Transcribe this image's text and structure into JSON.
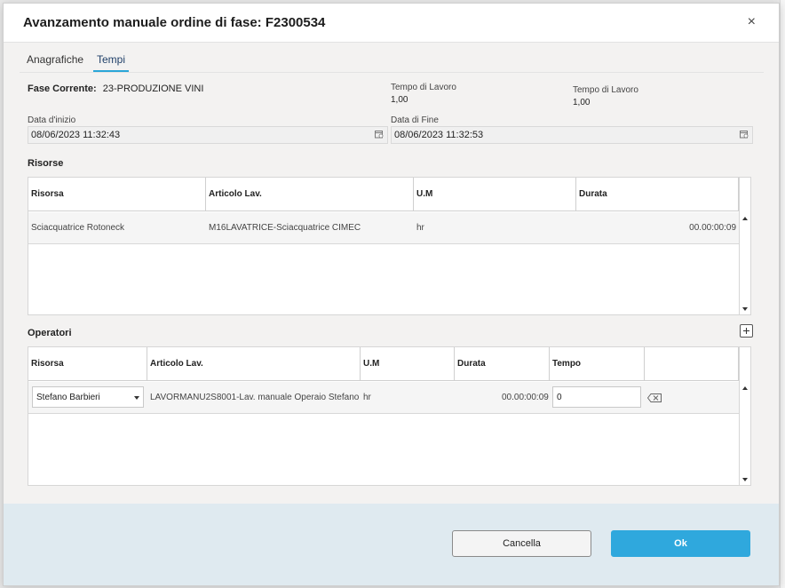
{
  "dialog": {
    "title": "Avanzamento manuale ordine di fase: F2300534",
    "close_glyph": "×"
  },
  "tabs": [
    {
      "label": "Anagrafiche",
      "active": false
    },
    {
      "label": "Tempi",
      "active": true
    }
  ],
  "fase": {
    "label": "Fase Corrente:",
    "value": "23-PRODUZIONE VINI"
  },
  "tempo_lavoro_1": {
    "label": "Tempo di Lavoro",
    "value": "1,00"
  },
  "tempo_lavoro_2": {
    "label": "Tempo di Lavoro",
    "value": "1,00"
  },
  "data_inizio": {
    "label": "Data d'inizio",
    "value": "08/06/2023 11:32:43"
  },
  "data_fine": {
    "label": "Data di Fine",
    "value": "08/06/2023 11:32:53"
  },
  "risorse": {
    "title": "Risorse",
    "columns": [
      "Risorsa",
      "Articolo Lav.",
      "U.M",
      "Durata"
    ],
    "rows": [
      {
        "risorsa": "Sciacquatrice Rotoneck",
        "articolo": "M16LAVATRICE-Sciacquatrice CIMEC",
        "um": "hr",
        "durata": "00.00:00:09"
      }
    ]
  },
  "operatori": {
    "title": "Operatori",
    "columns": [
      "Risorsa",
      "Articolo Lav.",
      "U.M",
      "Durata",
      "Tempo"
    ],
    "rows": [
      {
        "risorsa": "Stefano Barbieri",
        "articolo": "LAVORMANU2S8001-Lav. manuale Operaio Stefano",
        "um": "hr",
        "durata": "00.00:00:09",
        "tempo": "0"
      }
    ]
  },
  "footer": {
    "cancel_label": "Cancella",
    "ok_label": "Ok"
  },
  "colors": {
    "accent": "#2fa8dd",
    "footer_bg": "#dfeaf0"
  }
}
